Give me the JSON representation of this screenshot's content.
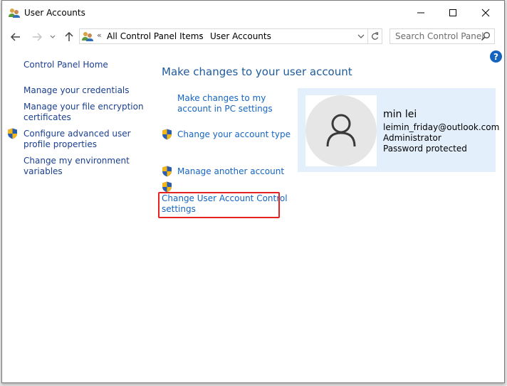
{
  "window": {
    "title": "User Accounts",
    "icon": "user-accounts-icon",
    "controls": {
      "minimize": "minimize-icon",
      "maximize": "maximize-icon",
      "close": "close-icon"
    }
  },
  "navigation": {
    "back_icon": "arrow-left-icon",
    "forward_icon": "arrow-right-icon",
    "recent_icon": "chevron-down-icon",
    "up_icon": "arrow-up-icon",
    "address": {
      "overflow_glyph": "«",
      "breadcrumbs": [
        "All Control Panel Items",
        "User Accounts"
      ],
      "separator": "›",
      "dropdown_icon": "chevron-down-icon",
      "refresh_icon": "refresh-icon"
    },
    "search": {
      "placeholder": "Search Control Panel",
      "icon": "search-icon"
    }
  },
  "help": {
    "glyph": "?",
    "icon": "help-icon"
  },
  "sidebar": {
    "items": [
      {
        "label_lines": [
          "Control Panel Home"
        ],
        "shield": false
      },
      {
        "label_lines": [
          "Manage your credentials"
        ],
        "shield": false
      },
      {
        "label_lines": [
          "Manage your file encryption",
          "certificates"
        ],
        "shield": false
      },
      {
        "label_lines": [
          "Configure advanced user",
          "profile properties"
        ],
        "shield": true
      },
      {
        "label_lines": [
          "Change my environment",
          "variables"
        ],
        "shield": false
      }
    ]
  },
  "main": {
    "heading": "Make changes to your user account",
    "tasks": [
      {
        "label_lines": [
          "Make changes to my",
          "account in PC settings"
        ],
        "shield": false
      },
      {
        "label_lines": [
          "Change your account type"
        ],
        "shield": true
      },
      {
        "label_lines": [
          "Manage another account"
        ],
        "shield": true
      },
      {
        "label_lines": [
          "Change User Account Control",
          "settings"
        ],
        "shield": true,
        "highlighted": true
      }
    ]
  },
  "account": {
    "avatar_icon": "user-silhouette-icon",
    "name": "min lei",
    "email": "leimin_friday@outlook.com",
    "role": "Administrator",
    "status": "Password protected"
  },
  "colors": {
    "link": "#1565c0",
    "sidebar_link": "#1a3f8f",
    "heading": "#1e5a9c",
    "card_bg": "#e3f0fc",
    "highlight": "#e32222"
  }
}
